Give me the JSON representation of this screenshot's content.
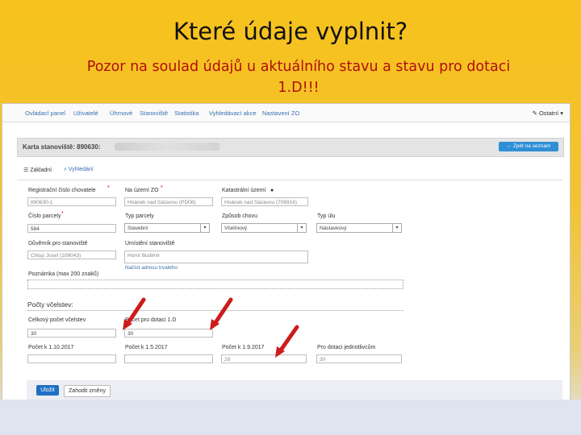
{
  "slide": {
    "title": "Které údaje vyplnit?",
    "subtitle": "Pozor na soulad údajů u aktuálního stavu a stavu pro dotaci  1.D!!!"
  },
  "nav": {
    "items": [
      "Ovládací panel",
      "Uživatelé",
      "Úhrnové",
      "Stanoviště",
      "Statistika",
      "Vyhledávací akce",
      "Nastavení ZO"
    ],
    "user": "Ostatní"
  },
  "card": {
    "title": "Karta stanoviště: 890630:",
    "back_button": "← Zpět na seznam"
  },
  "tabs": {
    "basic": "Základní",
    "search": "Vyhledání"
  },
  "form": {
    "reg_label": "Registrační číslo chovatele",
    "reg_value": "890630-1",
    "zo_label": "Na území ZO",
    "zo_value": "Hnánek nad Sázavou (PD08)",
    "cadastre_label": "Katastrální území",
    "cadastre_value": "Hnánek nad Sázavou (706916)",
    "parcel_label": "Číslo parcely",
    "parcel_value": "584",
    "parcel_type_label": "Typ parcely",
    "parcel_type_value": "Stavební",
    "method_label": "Způsob chovu",
    "method_value": "Včelínový",
    "hive_label": "Typ úlu",
    "hive_value": "Nástavkový",
    "trustee_label": "Důvěrník pro stanoviště",
    "trustee_value": "Chlup Josef (108043)",
    "location_label": "Umístění stanoviště",
    "location_value": "Horní Budimír",
    "location_link": "Načíst adresu trvalého",
    "note_label": "Poznámka (max 200 znaků)"
  },
  "colonies": {
    "section": "Počty včelstev:",
    "current_label": "Celkový počet včelstev",
    "current_value": "30",
    "subsidy_label": "Počet pro dotaci 1.D",
    "subsidy_value": "30",
    "c1_label": "Počet k 1.10.2017",
    "c1_value": "",
    "c2_label": "Počet k 1.5.2017",
    "c2_value": "",
    "c3_label": "Počet k 1.9.2017",
    "c3_value": "28",
    "c4_label": "Pro dotaci jednotlivcům",
    "c4_value": "30"
  },
  "buttons": {
    "save": "Uložit",
    "cancel": "Zahodit změny"
  },
  "colors": {
    "accent_red": "#b10d0d",
    "arrow": "#cc1c1c",
    "link_blue": "#3a6fb0",
    "primary_button": "#1f6fc3"
  }
}
